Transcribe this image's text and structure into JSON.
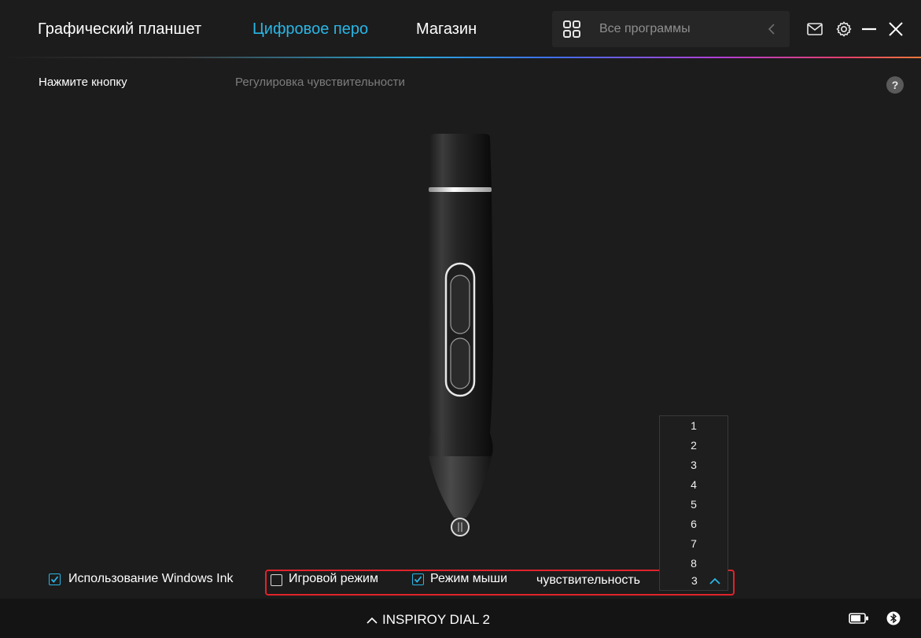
{
  "header": {
    "tabs": [
      {
        "label": "Графический планшет",
        "active": false
      },
      {
        "label": "Цифровое перо",
        "active": true
      },
      {
        "label": "Магазин",
        "active": false
      }
    ],
    "program_selector": {
      "label": "Все программы",
      "icon": "grid-icon"
    },
    "icons": [
      "mail-icon",
      "gear-icon",
      "minimize-icon",
      "close-icon"
    ],
    "accent_color": "#29b6e6"
  },
  "subtabs": [
    {
      "label": "Нажмите кнопку",
      "active": true
    },
    {
      "label": "Регулировка чувствительности",
      "active": false
    }
  ],
  "help": {
    "label": "?"
  },
  "controls": {
    "windows_ink": {
      "label": "Использование Windows Ink",
      "checked": true
    },
    "game_mode": {
      "label": "Игровой режим",
      "checked": false
    },
    "mouse_mode": {
      "label": "Режим мыши",
      "checked": true
    },
    "sensitivity": {
      "label": "чувствительность",
      "selected": "3",
      "options": [
        "1",
        "2",
        "3",
        "4",
        "5",
        "6",
        "7",
        "8"
      ]
    }
  },
  "footer": {
    "device_name": "INSPIROY DIAL 2",
    "icons": [
      "battery-icon",
      "bluetooth-icon"
    ]
  }
}
